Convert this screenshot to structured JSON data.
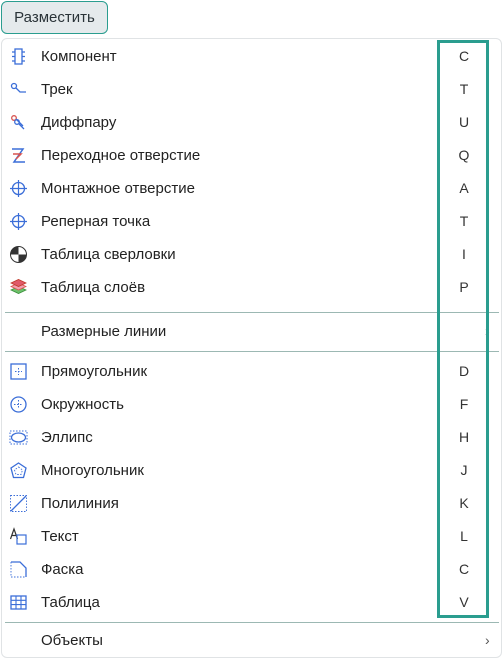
{
  "button": {
    "label": "Разместить"
  },
  "menu": {
    "group1": [
      {
        "label": "Компонент",
        "key": "C",
        "icon": "component-icon"
      },
      {
        "label": "Трек",
        "key": "T",
        "icon": "track-icon"
      },
      {
        "label": "Диффпару",
        "key": "U",
        "icon": "diff-pair-icon"
      },
      {
        "label": "Переходное отверстие",
        "key": "Q",
        "icon": "via-icon"
      },
      {
        "label": "Монтажное отверстие",
        "key": "A",
        "icon": "mounting-hole-icon"
      },
      {
        "label": "Реперная точка",
        "key": "T",
        "icon": "fiducial-icon"
      },
      {
        "label": "Таблица сверловки",
        "key": "I",
        "icon": "drill-table-icon"
      },
      {
        "label": "Таблица слоёв",
        "key": "P",
        "icon": "layer-stack-icon"
      }
    ],
    "dimensions": {
      "label": "Размерные линии"
    },
    "group2": [
      {
        "label": "Прямоугольник",
        "key": "D",
        "icon": "rectangle-icon"
      },
      {
        "label": "Окружность",
        "key": "F",
        "icon": "circle-icon"
      },
      {
        "label": "Эллипс",
        "key": "H",
        "icon": "ellipse-icon"
      },
      {
        "label": "Многоугольник",
        "key": "J",
        "icon": "polygon-icon"
      },
      {
        "label": "Полилиния",
        "key": "K",
        "icon": "polyline-icon"
      },
      {
        "label": "Текст",
        "key": "L",
        "icon": "text-icon"
      },
      {
        "label": "Фаска",
        "key": "C",
        "icon": "chamfer-icon"
      },
      {
        "label": "Таблица",
        "key": "V",
        "icon": "table-icon"
      }
    ],
    "objects": {
      "label": "Объекты"
    }
  },
  "colors": {
    "accent": "#2a9d8f",
    "icon_blue": "#3b6ed8",
    "icon_red": "#d9534f"
  }
}
